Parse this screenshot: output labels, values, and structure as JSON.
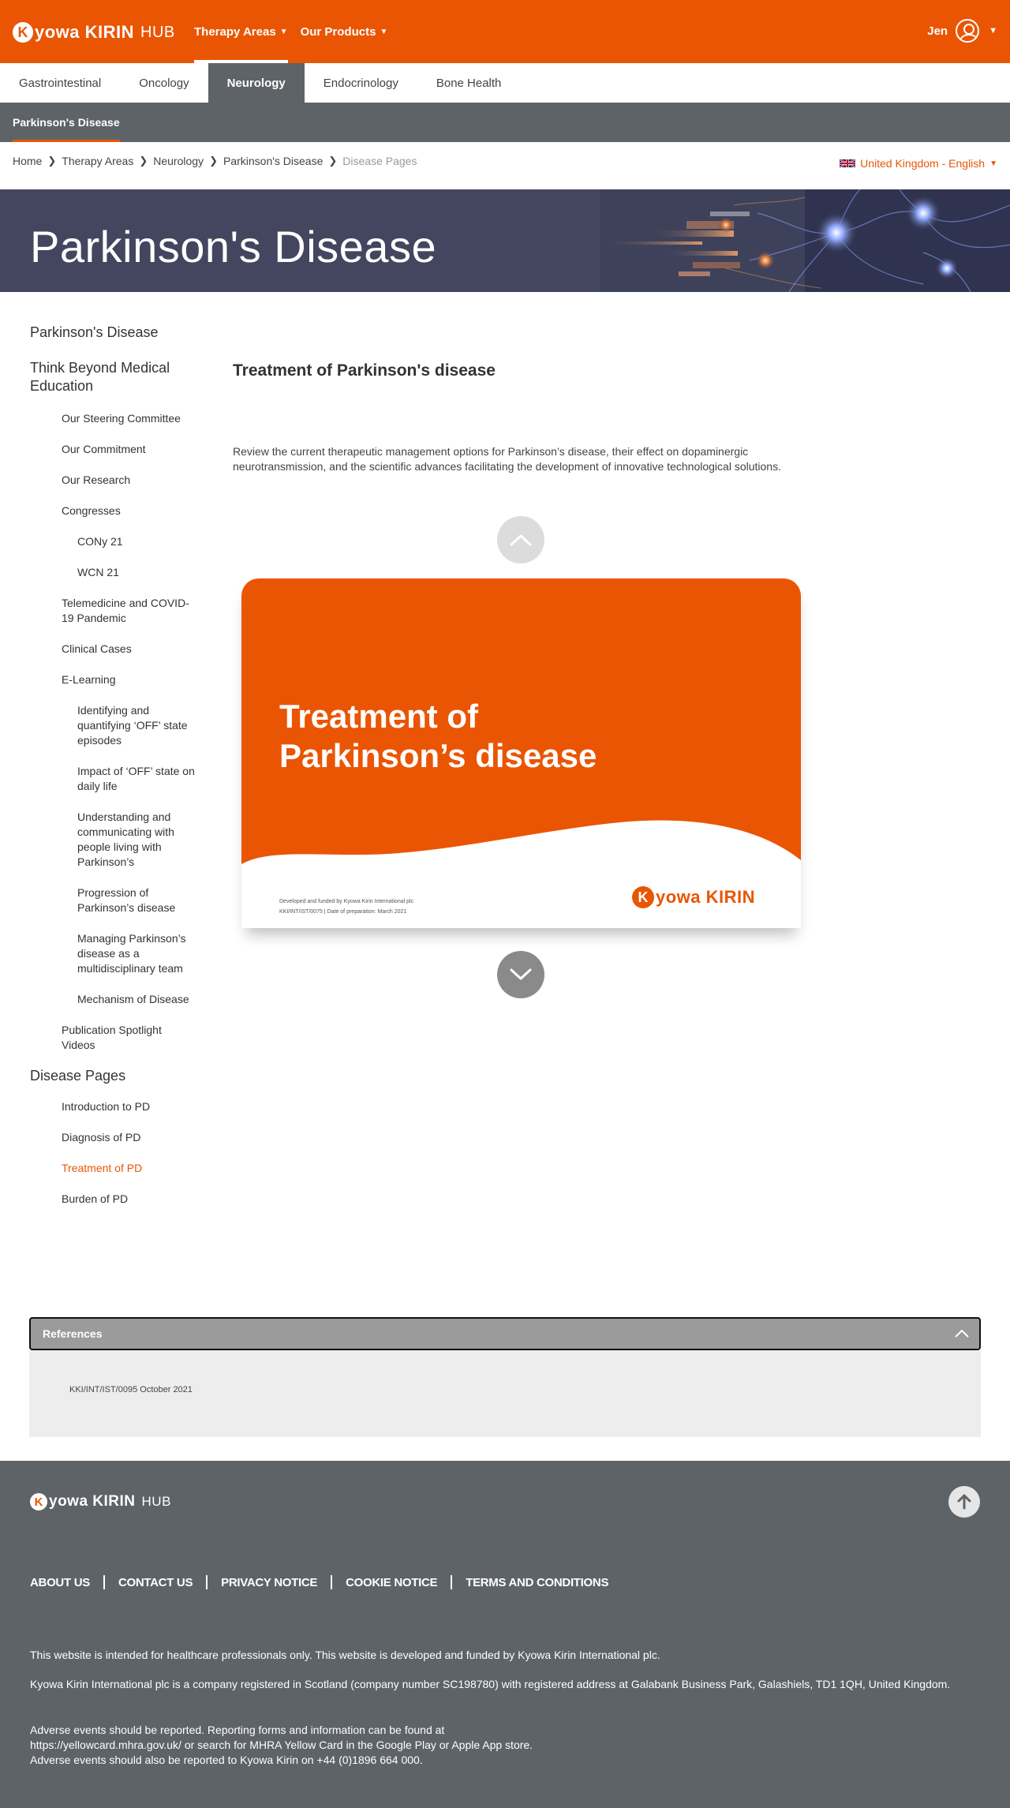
{
  "brand": {
    "logo_k": "K",
    "logo_word": "yowa KIRIN",
    "logo_hub": "HUB"
  },
  "topnav": {
    "items": [
      {
        "label": "Therapy Areas",
        "caret": "▼"
      },
      {
        "label": "Our Products",
        "caret": "▼"
      }
    ],
    "user_name": "Jen",
    "user_caret": "▼"
  },
  "category_tabs": [
    "Gastrointestinal",
    "Oncology",
    "Neurology",
    "Endocrinology",
    "Bone Health"
  ],
  "subbar": {
    "label": "Parkinson's Disease"
  },
  "breadcrumb": [
    "Home",
    "Therapy Areas",
    "Neurology",
    "Parkinson's Disease",
    "Disease Pages"
  ],
  "breadcrumb_sep": "❯",
  "locale": {
    "label": "United Kingdom - English",
    "caret": "▼"
  },
  "hero": {
    "title": "Parkinson's Disease"
  },
  "sidebar": {
    "parkinsons": "Parkinson's Disease",
    "think_beyond": "Think Beyond Medical Education",
    "steering": "Our Steering Committee",
    "commitment": "Our Commitment",
    "research": "Our Research",
    "congresses": "Congresses",
    "cony21": "CONy 21",
    "wcn21": "WCN 21",
    "telemedicine": "Telemedicine and COVID-19 Pandemic",
    "clinical_cases": "Clinical Cases",
    "elearning": "E-Learning",
    "el_identifying": "Identifying and quantifying ‘OFF’ state episodes",
    "el_impact": "Impact of ‘OFF’ state on daily life",
    "el_understanding": "Understanding and communicating with people living with Parkinson’s",
    "el_progression": "Progression of Parkinson’s disease",
    "el_managing": "Managing Parkinson’s disease as a multidisciplinary team",
    "el_mechanism": "Mechanism of Disease",
    "publication": "Publication Spotlight Videos",
    "disease_pages": "Disease Pages",
    "intro_pd": "Introduction to PD",
    "diagnosis_pd": "Diagnosis of PD",
    "treatment_pd": "Treatment of PD",
    "burden_pd": "Burden of PD"
  },
  "main": {
    "title": "Treatment of Parkinson's disease",
    "description": "Review the current therapeutic management options for Parkinson’s disease, their effect on dopaminergic neurotransmission, and the scientific advances facilitating the development of innovative technological solutions.",
    "slide": {
      "title_line1": "Treatment of",
      "title_line2": "Parkinson’s disease",
      "footer_line1": "Developed and funded by Kyowa Kirin International plc",
      "footer_line2": "KKI/INT/IST/0075 | Date of preparation: March 2021",
      "logo_k": "K",
      "logo_word": "yowa KIRIN",
      "bg_color": "#EA5504"
    }
  },
  "references": {
    "title": "References",
    "code": "KKI/INT/IST/0095 October 2021"
  },
  "footer": {
    "links": [
      "ABOUT US",
      "CONTACT US",
      "PRIVACY NOTICE",
      "COOKIE NOTICE",
      "TERMS AND CONDITIONS"
    ],
    "disclaimer": "This website is intended for healthcare professionals only. This website is developed and funded by Kyowa Kirin International plc.",
    "company": "Kyowa Kirin International plc is a company registered in Scotland (company number SC198780) with registered address at Galabank Business Park, Galashiels, TD1 1QH, United Kingdom.",
    "adverse_1": "Adverse events should be reported. Reporting forms and information can be found at",
    "adverse_2": "https://yellowcard.mhra.gov.uk/ or search for MHRA Yellow Card in the Google Play or Apple App store.",
    "adverse_3": "Adverse events should also be reported to Kyowa Kirin on +44 (0)1896 664 000."
  },
  "colors": {
    "brand_orange": "#EA5504",
    "nav_grey": "#5E6368",
    "hero_navy": "#44465F"
  },
  "icons": {
    "user": "user-circle-icon",
    "flag": "uk-flag-icon",
    "arrow_up": "chevron-up-icon",
    "arrow_down": "chevron-down-icon",
    "back_to_top": "arrow-up-icon"
  }
}
